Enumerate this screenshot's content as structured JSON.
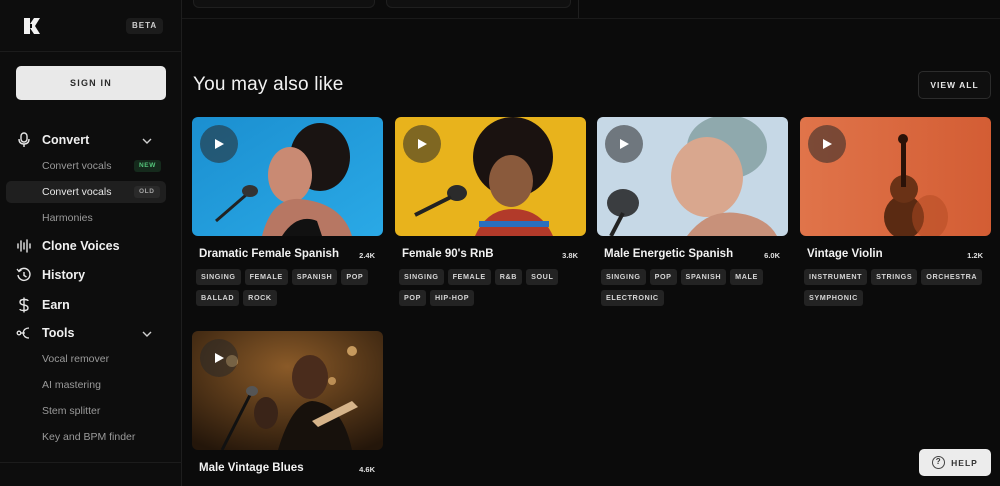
{
  "sidebar": {
    "beta": "BETA",
    "sign_in": "SIGN IN",
    "convert": {
      "label": "Convert",
      "items": [
        {
          "label": "Convert vocals",
          "tag": "NEW"
        },
        {
          "label": "Convert vocals",
          "tag": "OLD"
        },
        {
          "label": "Harmonies"
        }
      ]
    },
    "clone_voices": "Clone Voices",
    "history": "History",
    "earn": "Earn",
    "tools": {
      "label": "Tools",
      "items": [
        {
          "label": "Vocal remover"
        },
        {
          "label": "AI mastering"
        },
        {
          "label": "Stem splitter"
        },
        {
          "label": "Key and BPM finder"
        }
      ]
    }
  },
  "main": {
    "section_title": "You may also like",
    "view_all": "VIEW ALL",
    "cards": [
      {
        "title": "Dramatic Female Spanish",
        "count": "2.4K",
        "tags": [
          "SINGING",
          "FEMALE",
          "SPANISH",
          "POP",
          "BALLAD",
          "ROCK"
        ]
      },
      {
        "title": "Female 90's RnB",
        "count": "3.8K",
        "tags": [
          "SINGING",
          "FEMALE",
          "R&B",
          "SOUL",
          "POP",
          "HIP-HOP"
        ]
      },
      {
        "title": "Male Energetic Spanish",
        "count": "6.0K",
        "tags": [
          "SINGING",
          "POP",
          "SPANISH",
          "MALE",
          "ELECTRONIC"
        ]
      },
      {
        "title": "Vintage Violin",
        "count": "1.2K",
        "tags": [
          "INSTRUMENT",
          "STRINGS",
          "ORCHESTRA",
          "SYMPHONIC"
        ]
      },
      {
        "title": "Male Vintage Blues",
        "count": "4.6K",
        "tags": []
      }
    ]
  },
  "help": "HELP",
  "colors": {
    "background": "#0b0b0b",
    "accent_new": "#54c47a",
    "card1_bg": "#1f9ad8",
    "card2_bg": "#e8b31c",
    "card3_bg": "#c6d8e6",
    "card4_bg": "#e0744a",
    "card5_bg": "#3a2410"
  }
}
